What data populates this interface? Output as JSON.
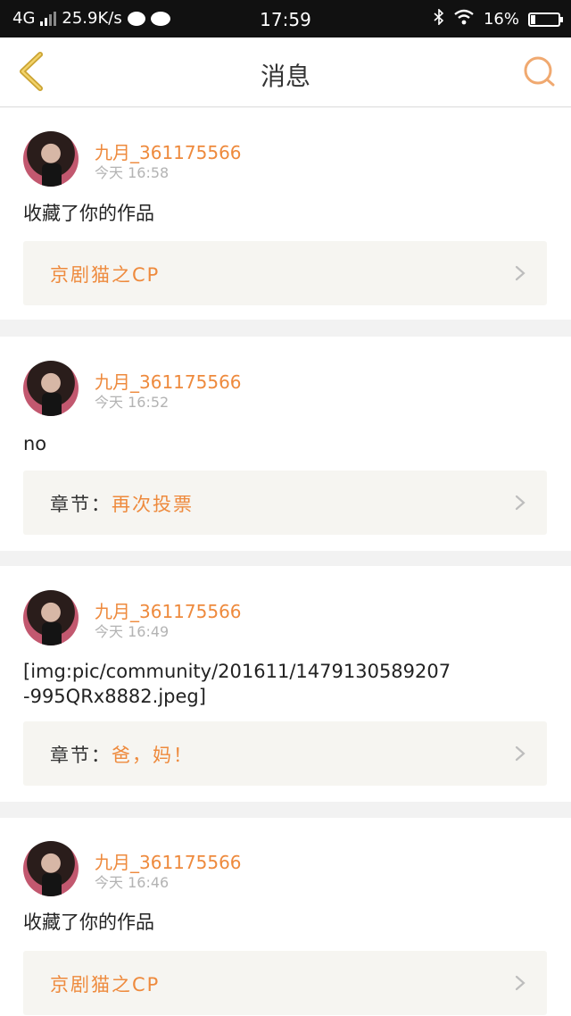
{
  "status_bar": {
    "network": "4G",
    "speed": "25.9K/s",
    "time": "17:59",
    "battery": "16%",
    "battery_level": 0.16
  },
  "header": {
    "title": "消息",
    "back_icon": "chevron-left-icon",
    "search_icon": "search-icon",
    "accent_color": "#ee8a3d"
  },
  "messages": [
    {
      "user": "九月_361175566",
      "time": "今天 16:58",
      "content": "收藏了你的作品",
      "ref_prefix": "",
      "ref_title": "京剧猫之CP"
    },
    {
      "user": "九月_361175566",
      "time": "今天 16:52",
      "content": "no",
      "ref_prefix": "章节：",
      "ref_title": "再次投票"
    },
    {
      "user": "九月_361175566",
      "time": "今天 16:49",
      "content": "[img:pic/community/201611/1479130589207-995QRx8882.jpeg]",
      "ref_prefix": "章节：",
      "ref_title": "爸，妈！"
    },
    {
      "user": "九月_361175566",
      "time": "今天 16:46",
      "content": "收藏了你的作品",
      "ref_prefix": "",
      "ref_title": "京剧猫之CP"
    }
  ]
}
